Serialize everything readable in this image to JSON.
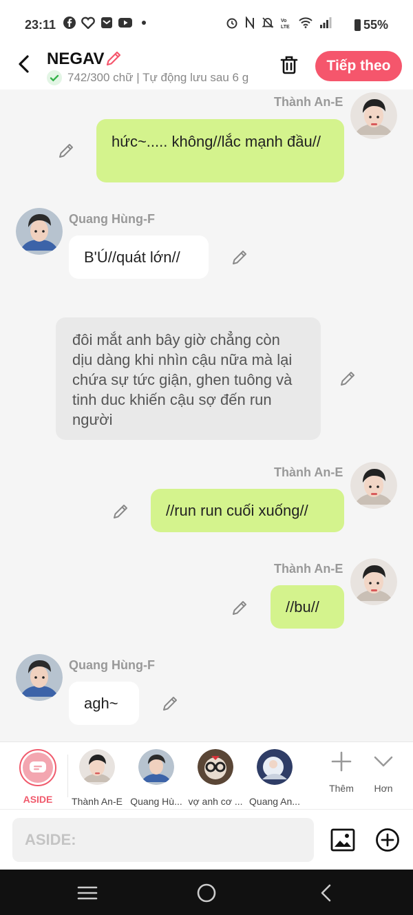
{
  "status_bar": {
    "time": "23:11",
    "battery": "55%",
    "left_icons": [
      "facebook-icon",
      "app-icon",
      "tasks-icon",
      "youtube-icon",
      "dot-icon"
    ],
    "right_icons": [
      "alarm-icon",
      "nfc-icon",
      "mute-icon",
      "volte-icon",
      "wifi-icon",
      "signal-icon",
      "battery-icon"
    ]
  },
  "header": {
    "title": "NEGAV",
    "subtitle": "742/300 chữ | Tự động lưu sau 6 g",
    "next_label": "Tiếp theo",
    "accent": "#f5566c"
  },
  "messages": [
    {
      "sender": "Thành An-E",
      "text": "hức~..... không//lắc mạnh đầu//"
    },
    {
      "sender": "Quang Hùng-F",
      "text": "B'Ú//quát lớn//"
    },
    {
      "sender": "",
      "text": "đôi mắt anh bây giờ chẳng còn dịu dàng khi nhìn cậu nữa mà lại chứa sự tức giận, ghen tuông và tinh duc khiến cậu sợ đến run người"
    },
    {
      "sender": "Thành An-E",
      "text": "//run run cuối xuống//"
    },
    {
      "sender": "Thành An-E",
      "text": "//bu//"
    },
    {
      "sender": "Quang Hùng-F",
      "text": "agh~"
    }
  ],
  "cast": [
    {
      "label": "ASIDE"
    },
    {
      "label": "Thành An-E"
    },
    {
      "label": "Quang Hù..."
    },
    {
      "label": "vợ anh cơ ..."
    },
    {
      "label": "Quang An..."
    }
  ],
  "tools": {
    "more_label": "Thêm",
    "expand_label": "Hơn"
  },
  "input": {
    "placeholder": "ASIDE:"
  }
}
